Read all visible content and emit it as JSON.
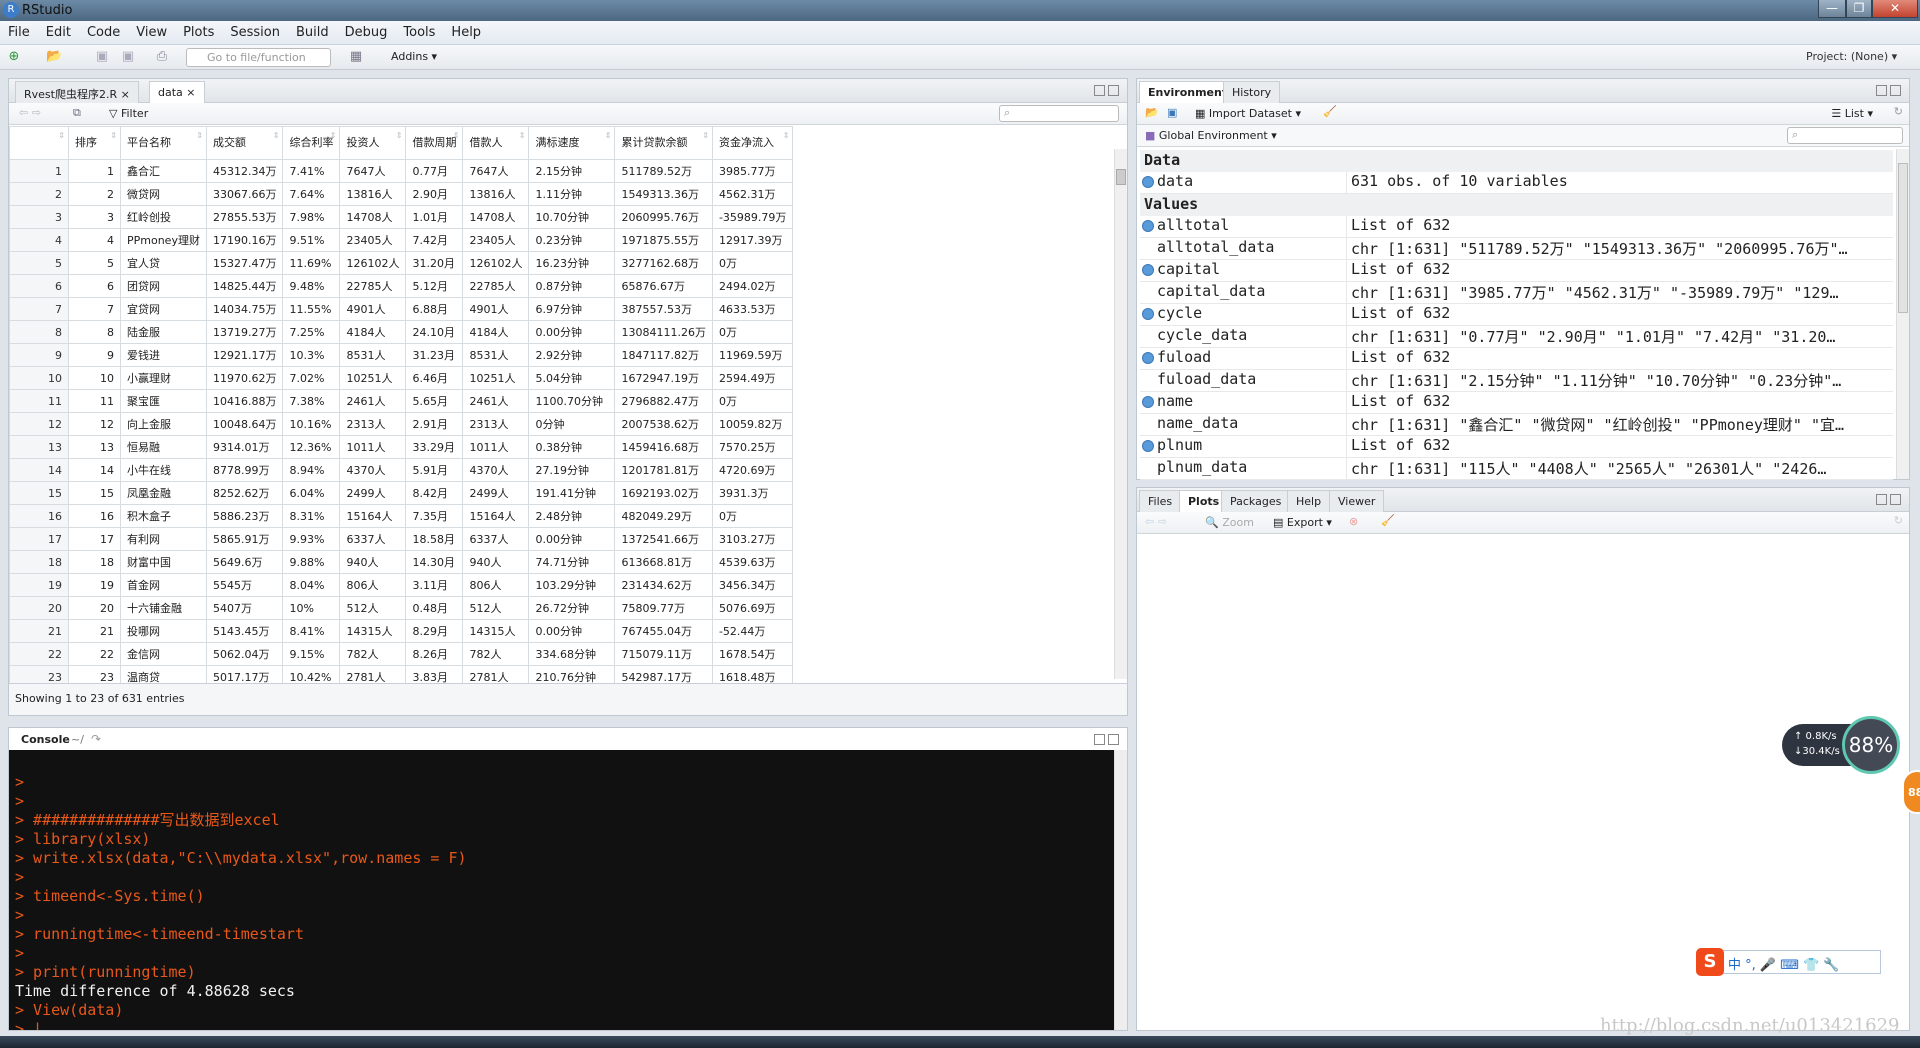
{
  "window": {
    "title": "RStudio",
    "min": "—",
    "restore": "❐",
    "close": "✕"
  },
  "menu": [
    "File",
    "Edit",
    "Code",
    "View",
    "Plots",
    "Session",
    "Build",
    "Debug",
    "Tools",
    "Help"
  ],
  "toolbar": {
    "goto_placeholder": "Go to file/function",
    "addins": "Addins ▾",
    "project": "Project: (None) ▾"
  },
  "source": {
    "tabs": [
      {
        "label": "Rvest爬虫程序2.R ×"
      },
      {
        "label": "data ×"
      }
    ],
    "filter": "Filter",
    "columns": [
      "",
      "排序",
      "平台名称",
      "成交额",
      "综合利率",
      "投资人",
      "借款周期",
      "借款人",
      "满标速度",
      "累计贷款余额",
      "资金净流入"
    ],
    "rows": [
      [
        "1",
        "1",
        "鑫合汇",
        "45312.34万",
        "7.41%",
        "7647人",
        "0.77月",
        "7647人",
        "2.15分钟",
        "511789.52万",
        "3985.77万"
      ],
      [
        "2",
        "2",
        "微贷网",
        "33067.66万",
        "7.64%",
        "13816人",
        "2.90月",
        "13816人",
        "1.11分钟",
        "1549313.36万",
        "4562.31万"
      ],
      [
        "3",
        "3",
        "红岭创投",
        "27855.53万",
        "7.98%",
        "14708人",
        "1.01月",
        "14708人",
        "10.70分钟",
        "2060995.76万",
        "-35989.79万"
      ],
      [
        "4",
        "4",
        "PPmoney理财",
        "17190.16万",
        "9.51%",
        "23405人",
        "7.42月",
        "23405人",
        "0.23分钟",
        "1971875.55万",
        "12917.39万"
      ],
      [
        "5",
        "5",
        "宜人贷",
        "15327.47万",
        "11.69%",
        "126102人",
        "31.20月",
        "126102人",
        "16.23分钟",
        "3277162.68万",
        "0万"
      ],
      [
        "6",
        "6",
        "团贷网",
        "14825.44万",
        "9.48%",
        "22785人",
        "5.12月",
        "22785人",
        "0.87分钟",
        "65876.67万",
        "2494.02万"
      ],
      [
        "7",
        "7",
        "宜贷网",
        "14034.75万",
        "11.55%",
        "4901人",
        "6.88月",
        "4901人",
        "6.97分钟",
        "387557.53万",
        "4633.53万"
      ],
      [
        "8",
        "8",
        "陆金服",
        "13719.27万",
        "7.25%",
        "4184人",
        "24.10月",
        "4184人",
        "0.00分钟",
        "13084111.26万",
        "0万"
      ],
      [
        "9",
        "9",
        "爱钱进",
        "12921.17万",
        "10.3%",
        "8531人",
        "31.23月",
        "8531人",
        "2.92分钟",
        "1847117.82万",
        "11969.59万"
      ],
      [
        "10",
        "10",
        "小赢理财",
        "11970.62万",
        "7.02%",
        "10251人",
        "6.46月",
        "10251人",
        "5.04分钟",
        "1672947.19万",
        "2594.49万"
      ],
      [
        "11",
        "11",
        "聚宝匯",
        "10416.88万",
        "7.38%",
        "2461人",
        "5.65月",
        "2461人",
        "1100.70分钟",
        "2796882.47万",
        "0万"
      ],
      [
        "12",
        "12",
        "向上金服",
        "10048.64万",
        "10.16%",
        "2313人",
        "2.91月",
        "2313人",
        "0分钟",
        "2007538.62万",
        "10059.82万"
      ],
      [
        "13",
        "13",
        "恒易融",
        "9314.01万",
        "12.36%",
        "1011人",
        "33.29月",
        "1011人",
        "0.38分钟",
        "1459416.68万",
        "7570.25万"
      ],
      [
        "14",
        "14",
        "小牛在线",
        "8778.99万",
        "8.94%",
        "4370人",
        "5.91月",
        "4370人",
        "27.19分钟",
        "1201781.81万",
        "4720.69万"
      ],
      [
        "15",
        "15",
        "凤凰金融",
        "8252.62万",
        "6.04%",
        "2499人",
        "8.42月",
        "2499人",
        "191.41分钟",
        "1692193.02万",
        "3931.3万"
      ],
      [
        "16",
        "16",
        "积木盒子",
        "5886.23万",
        "8.31%",
        "15164人",
        "7.35月",
        "15164人",
        "2.48分钟",
        "482049.29万",
        "0万"
      ],
      [
        "17",
        "17",
        "有利网",
        "5865.91万",
        "9.93%",
        "6337人",
        "18.58月",
        "6337人",
        "0.00分钟",
        "1372541.66万",
        "3103.27万"
      ],
      [
        "18",
        "18",
        "财富中国",
        "5649.6万",
        "9.88%",
        "940人",
        "14.30月",
        "940人",
        "74.71分钟",
        "613668.81万",
        "4539.63万"
      ],
      [
        "19",
        "19",
        "首金网",
        "5545万",
        "8.04%",
        "806人",
        "3.11月",
        "806人",
        "103.29分钟",
        "231434.62万",
        "3456.34万"
      ],
      [
        "20",
        "20",
        "十六铺金融",
        "5407万",
        "10%",
        "512人",
        "0.48月",
        "512人",
        "26.72分钟",
        "75809.77万",
        "5076.69万"
      ],
      [
        "21",
        "21",
        "投哪网",
        "5143.45万",
        "8.41%",
        "14315人",
        "8.29月",
        "14315人",
        "0.00分钟",
        "767455.04万",
        "-52.44万"
      ],
      [
        "22",
        "22",
        "金信网",
        "5062.04万",
        "9.15%",
        "782人",
        "8.26月",
        "782人",
        "334.68分钟",
        "715079.11万",
        "1678.54万"
      ],
      [
        "23",
        "23",
        "温商贷",
        "5017.17万",
        "10.42%",
        "2781人",
        "3.83月",
        "2781人",
        "210.76分钟",
        "542987.17万",
        "1618.48万"
      ]
    ],
    "footer": "Showing 1 to 23 of 631 entries"
  },
  "console": {
    "title": "Console",
    "path": "~/",
    "lines": [
      {
        "t": ">",
        "out": false
      },
      {
        "t": ">",
        "out": false
      },
      {
        "t": "> ##############写出数据到excel",
        "out": false
      },
      {
        "t": "> library(xlsx)",
        "out": false
      },
      {
        "t": "> write.xlsx(data,\"C:\\\\mydata.xlsx\",row.names = F)",
        "out": false
      },
      {
        "t": ">",
        "out": false
      },
      {
        "t": "> timeend<-Sys.time()",
        "out": false
      },
      {
        "t": ">",
        "out": false
      },
      {
        "t": "> runningtime<-timeend-timestart",
        "out": false
      },
      {
        "t": ">",
        "out": false
      },
      {
        "t": "> print(runningtime)",
        "out": false
      },
      {
        "t": "Time difference of 4.88628 secs",
        "out": true
      },
      {
        "t": "> View(data)",
        "out": false
      },
      {
        "t": "> |",
        "out": false
      }
    ]
  },
  "env": {
    "tabs": [
      "Environment",
      "History"
    ],
    "import": "Import Dataset ▾",
    "list": "List ▾",
    "scope": "Global Environment ▾",
    "sections": [
      {
        "title": "Data",
        "rows": [
          {
            "k": "data",
            "v": "631 obs. of 10 variables",
            "exp": true
          }
        ]
      },
      {
        "title": "Values",
        "rows": [
          {
            "k": "alltotal",
            "v": "List of 632",
            "exp": true
          },
          {
            "k": "alltotal_data",
            "v": "chr [1:631] \"511789.52万\" \"1549313.36万\" \"2060995.76万\"…",
            "exp": false
          },
          {
            "k": "capital",
            "v": "List of 632",
            "exp": true
          },
          {
            "k": "capital_data",
            "v": "chr [1:631] \"3985.77万\" \"4562.31万\" \"-35989.79万\" \"129…",
            "exp": false
          },
          {
            "k": "cycle",
            "v": "List of 632",
            "exp": true
          },
          {
            "k": "cycle_data",
            "v": "chr [1:631] \"0.77月\" \"2.90月\" \"1.01月\" \"7.42月\" \"31.20…",
            "exp": false
          },
          {
            "k": "fuload",
            "v": "List of 632",
            "exp": true
          },
          {
            "k": "fuload_data",
            "v": "chr [1:631] \"2.15分钟\" \"1.11分钟\" \"10.70分钟\" \"0.23分钟\"…",
            "exp": false
          },
          {
            "k": "name",
            "v": "List of 632",
            "exp": true
          },
          {
            "k": "name_data",
            "v": "chr [1:631] \"鑫合汇\" \"微贷网\" \"红岭创投\" \"PPmoney理财\" \"宜…",
            "exp": false
          },
          {
            "k": "plnum",
            "v": "List of 632",
            "exp": true
          },
          {
            "k": "plnum_data",
            "v": "chr [1:631] \"115人\" \"4408人\" \"2565人\" \"26301人\" \"2426…",
            "exp": false
          }
        ]
      }
    ]
  },
  "files": {
    "tabs": [
      "Files",
      "Plots",
      "Packages",
      "Help",
      "Viewer"
    ],
    "zoom": "Zoom",
    "export": "Export ▾"
  },
  "overlay": {
    "up": "↑ 0.8K/s",
    "down": "↓30.4K/s",
    "pct": "88%",
    "badge": "88",
    "ime": "中 °, 🎤 ⌨ 👕 🔧",
    "watermark": "http://blog.csdn.net/u013421629"
  },
  "colors": {
    "console_bg": "#111111",
    "console_cmd": "#e8581a",
    "accent": "#5a9ad8"
  }
}
